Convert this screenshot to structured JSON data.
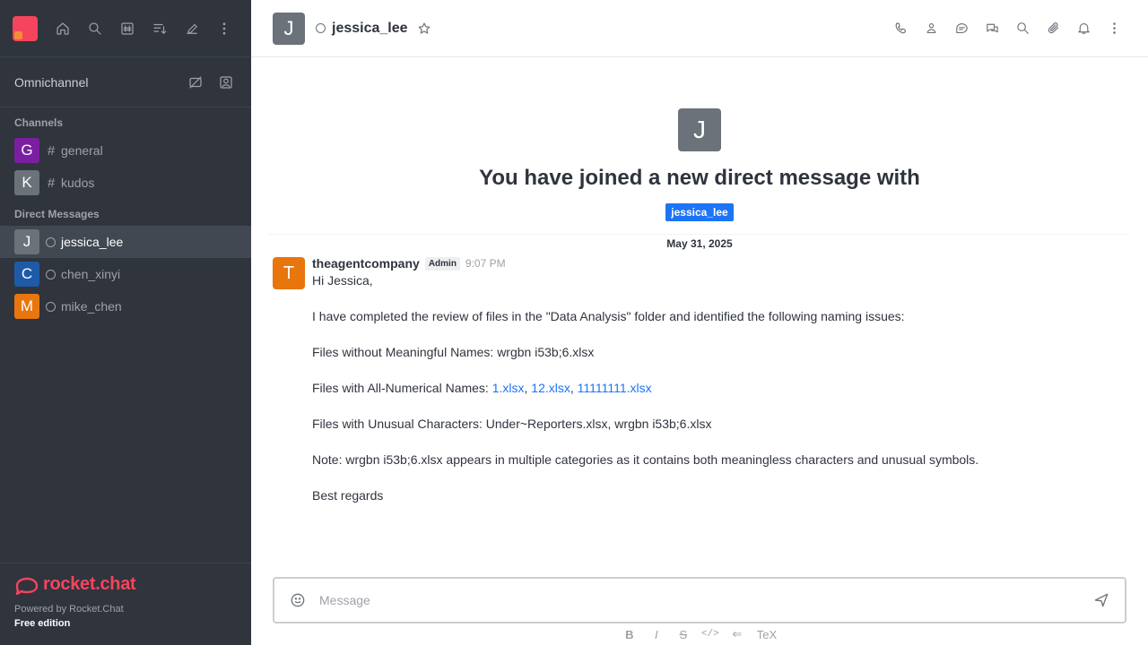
{
  "sidebar": {
    "omnichannel_label": "Omnichannel",
    "channels_title": "Channels",
    "channels": [
      {
        "avatar_letter": "G",
        "avatar_color": "#7b1fa2",
        "name": "general"
      },
      {
        "avatar_letter": "K",
        "avatar_color": "#6c727a",
        "name": "kudos"
      }
    ],
    "dm_title": "Direct Messages",
    "direct_messages": [
      {
        "avatar_letter": "J",
        "avatar_color": "#6c727a",
        "name": "jessica_lee"
      },
      {
        "avatar_letter": "C",
        "avatar_color": "#1e5aa8",
        "name": "chen_xinyi"
      },
      {
        "avatar_letter": "M",
        "avatar_color": "#e8760c",
        "name": "mike_chen"
      }
    ],
    "footer": {
      "logo_text": "rocket.chat",
      "powered_by": "Powered by Rocket.Chat",
      "edition": "Free edition"
    }
  },
  "header": {
    "avatar_letter": "J",
    "room_name": "jessica_lee"
  },
  "welcome": {
    "avatar_letter": "J",
    "title": "You have joined a new direct message with",
    "mention": "jessica_lee"
  },
  "date_divider": "May 31, 2025",
  "message": {
    "avatar_letter": "T",
    "username": "theagentcompany",
    "role": "Admin",
    "time": "9:07 PM",
    "greeting": "Hi Jessica,",
    "intro": "I have completed the review of files in the \"Data Analysis\" folder and identified the following naming issues:",
    "meaningless": "Files without Meaningful Names: wrgbn i53b;6.xlsx",
    "numerical_prefix": "Files with All-Numerical Names: ",
    "numerical_files": [
      "1.xlsx",
      "12.xlsx",
      "11111111.xlsx"
    ],
    "numerical_sep": ", ",
    "unusual": "Files with Unusual Characters: Under~Reporters.xlsx, wrgbn i53b;6.xlsx",
    "note": "Note: wrgbn i53b;6.xlsx appears in multiple categories as it contains both meaningless characters and unusual symbols.",
    "signoff": "Best regards"
  },
  "composer": {
    "placeholder": "Message"
  },
  "format_bar": {
    "bold": "B",
    "italic": "I",
    "strike": "S",
    "code": "</>",
    "link": "⇐",
    "katex": "TeX"
  }
}
